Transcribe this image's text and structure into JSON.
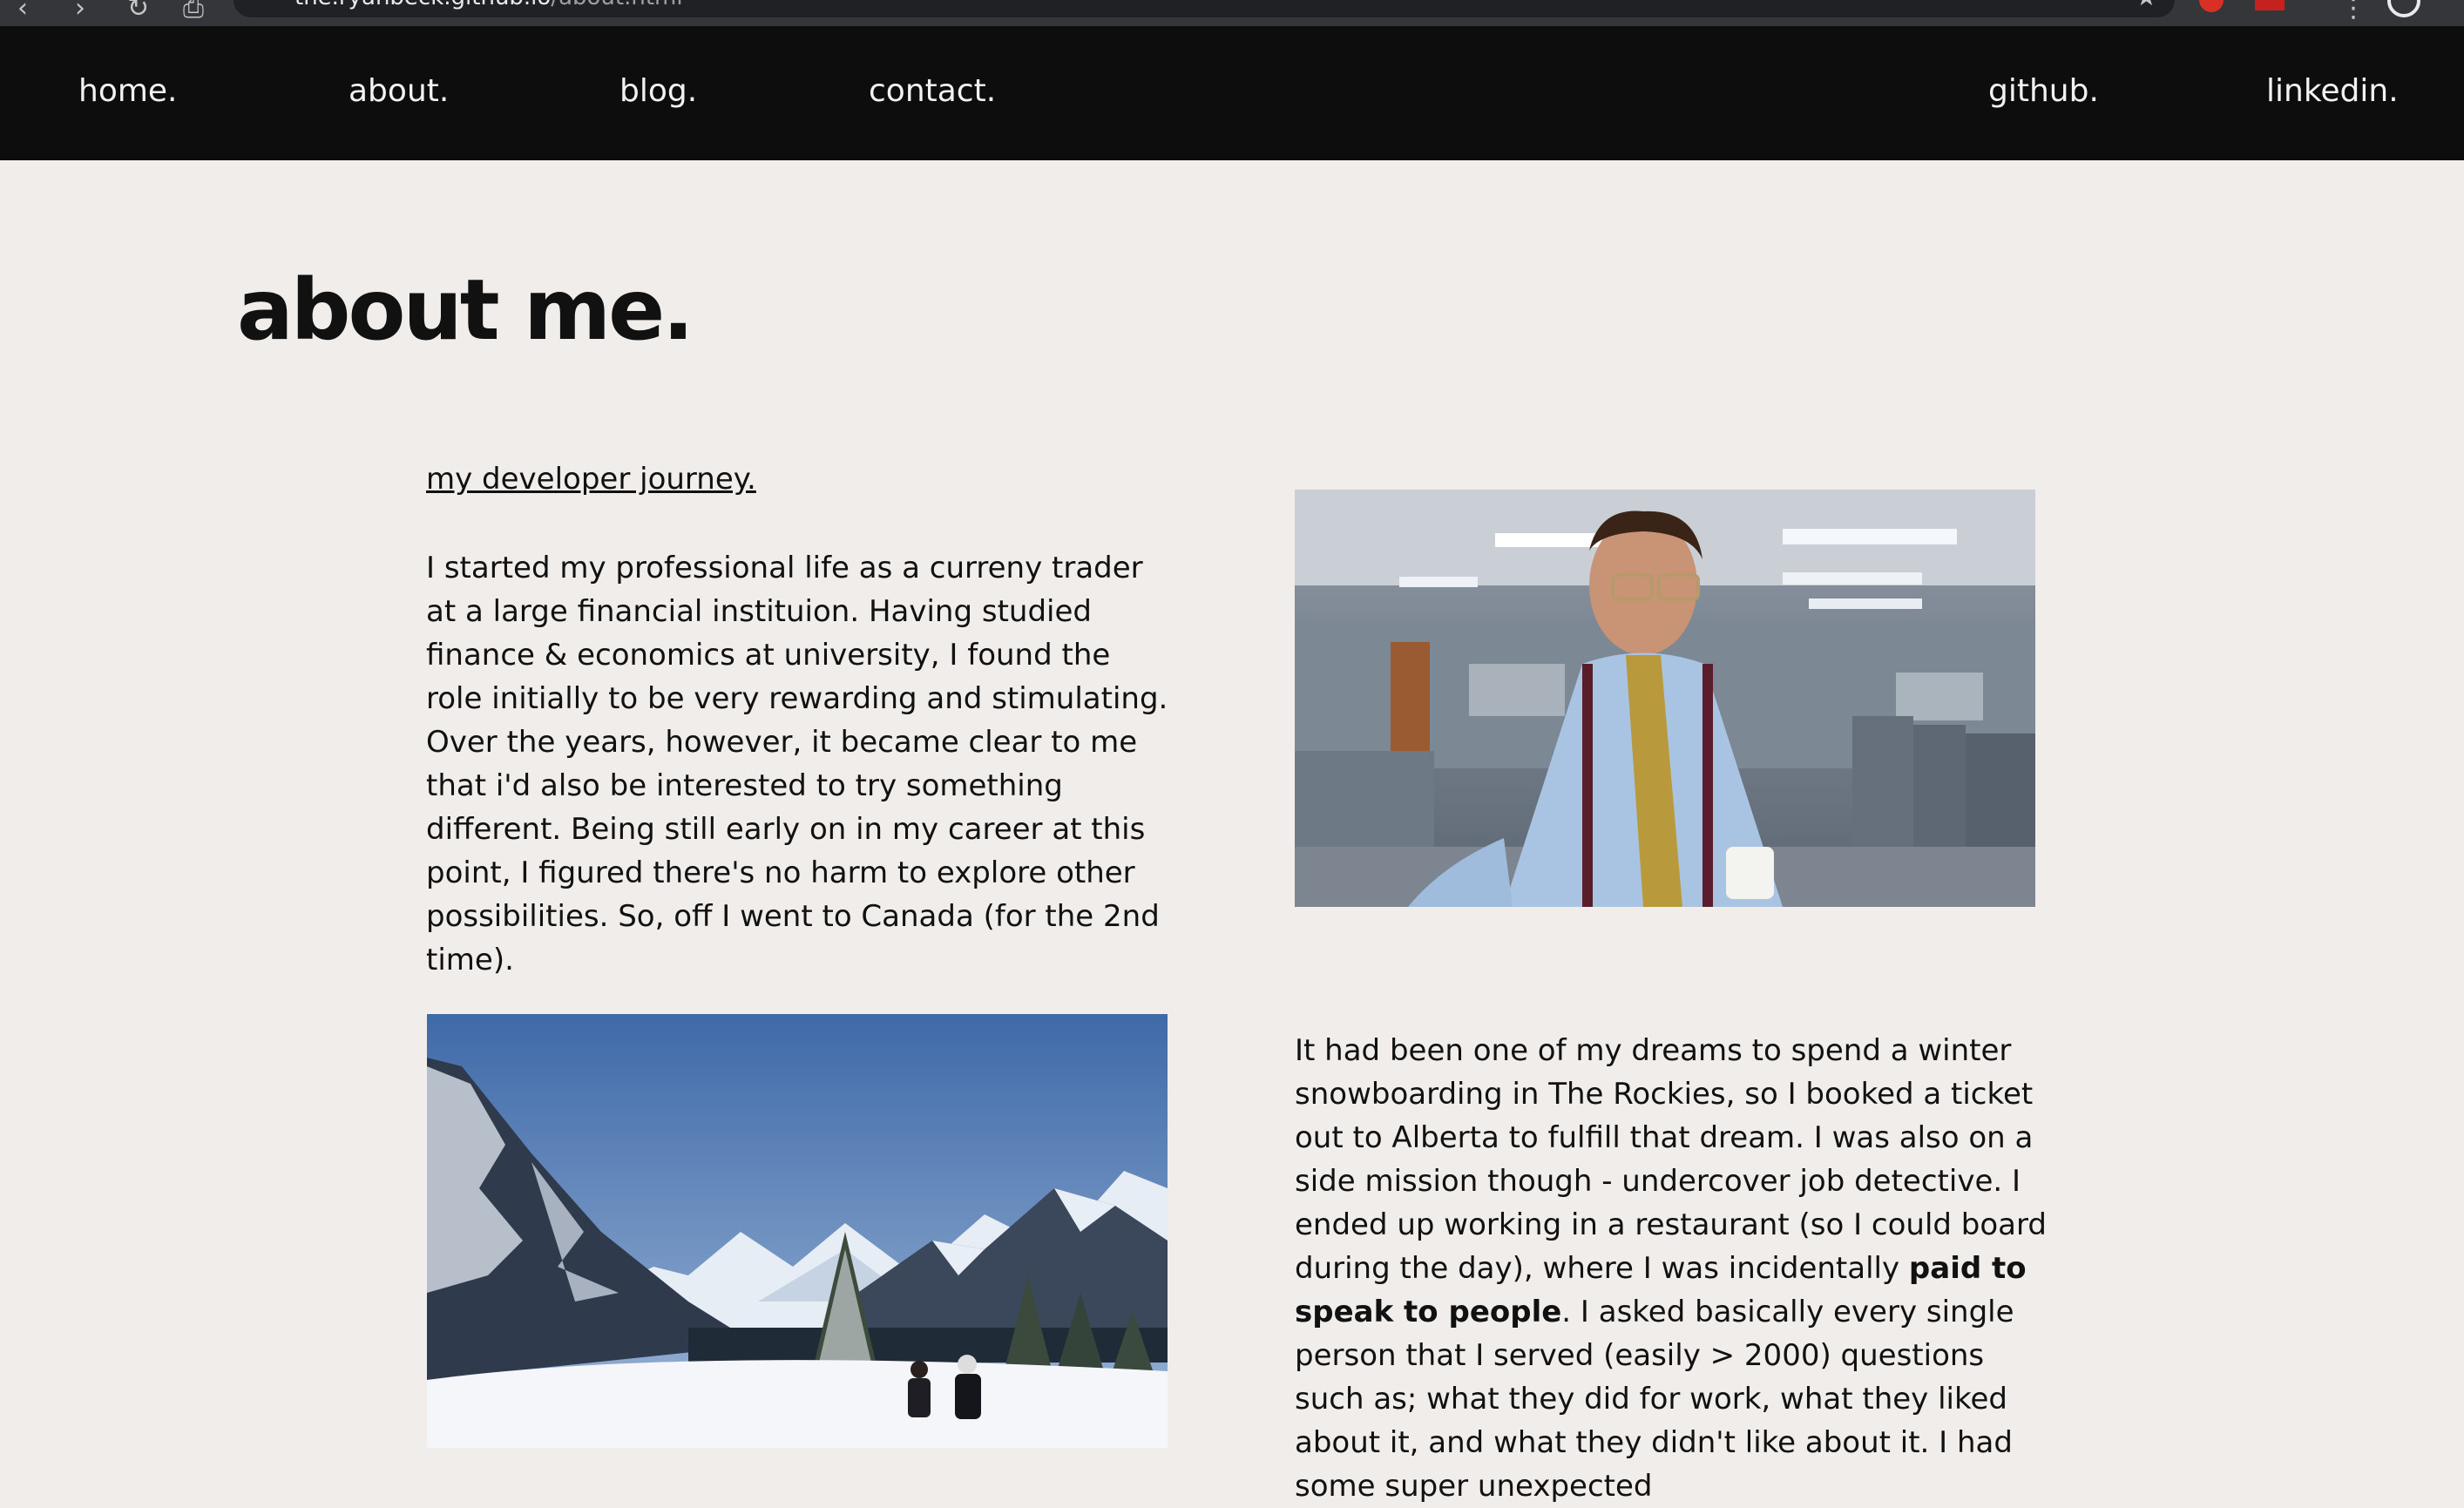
{
  "browser": {
    "url_host": "the.ryanbeck.github.io",
    "url_path": "/about.html"
  },
  "nav": {
    "home": "home.",
    "about": "about.",
    "blog": "blog.",
    "contact": "contact.",
    "github": "github.",
    "linkedin": "linkedin."
  },
  "page": {
    "title": "about me.",
    "section_heading": "my developer journey.",
    "paragraph_1": "I started my professional life as a curreny trader at a large financial instituion. Having studied finance & economics at university, I found the role initially to be very rewarding and stimulating. Over the years, however, it became clear to me that i'd also be interested to try something different. Being still early on in my career at this point, I figured there's no harm to explore other possibilities. So, off I went to Canada (for the 2nd time).",
    "paragraph_2_start": "It had been one of my dreams to spend a winter snowboarding in The Rockies, so I booked a ticket out to Alberta to fulfill that dream. I was also on a side mission though - undercover job detective. I ended up working in a restaurant (so I could board during the day), where I was incidentally ",
    "paragraph_2_bold": "paid to speak to people",
    "paragraph_2_end": ". I asked basically every single person that I served (easily > 2000) questions such as; what they did for work, what they liked about it, and what they didn't like about it. I had some super unexpected"
  },
  "colors": {
    "page_bg": "#f0edeb",
    "nav_bg": "#0d0d0d",
    "nav_text": "#f2f2f2",
    "text": "#111111"
  },
  "icons": [
    "star-icon",
    "back-icon",
    "forward-icon",
    "reload-icon",
    "profile-icon"
  ]
}
